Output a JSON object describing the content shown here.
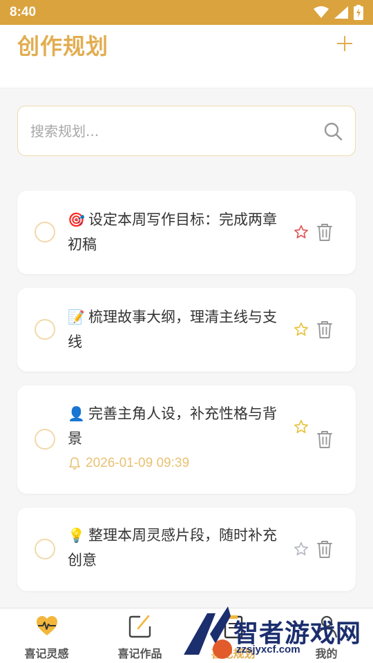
{
  "status_bar": {
    "time": "8:40"
  },
  "header": {
    "title": "创作规划"
  },
  "search": {
    "placeholder": "搜索规划..."
  },
  "plans": [
    {
      "emoji": "🎯",
      "text": "设定本周写作目标：完成两章初稿",
      "starred": true,
      "star_color": "#e05555"
    },
    {
      "emoji": "📝",
      "text": "梳理故事大纲，理清主线与支线",
      "starred": true,
      "star_color": "#e8c23c"
    },
    {
      "emoji": "👤",
      "text": "完善主角人设，补充性格与背景",
      "starred": true,
      "star_color": "#e8c23c",
      "reminder": "2026-01-09 09:39"
    },
    {
      "emoji": "💡",
      "text": "整理本周灵感片段，随时补充创意",
      "starred": false,
      "star_color": "#b4b8c0"
    }
  ],
  "tabs": [
    {
      "label": "喜记灵感",
      "icon": "heart-pulse-icon"
    },
    {
      "label": "喜记作品",
      "icon": "edit-square-icon"
    },
    {
      "label": "喜记规划",
      "icon": "clipboard-icon",
      "active": true
    },
    {
      "label": "我的",
      "icon": "user-icon"
    }
  ],
  "watermark": {
    "text": "智者游戏网",
    "url": "zzsjyxcf.com"
  },
  "colors": {
    "accent": "#e2ad50",
    "status_bar": "#dba33d",
    "check_border": "#f1d9a9"
  }
}
